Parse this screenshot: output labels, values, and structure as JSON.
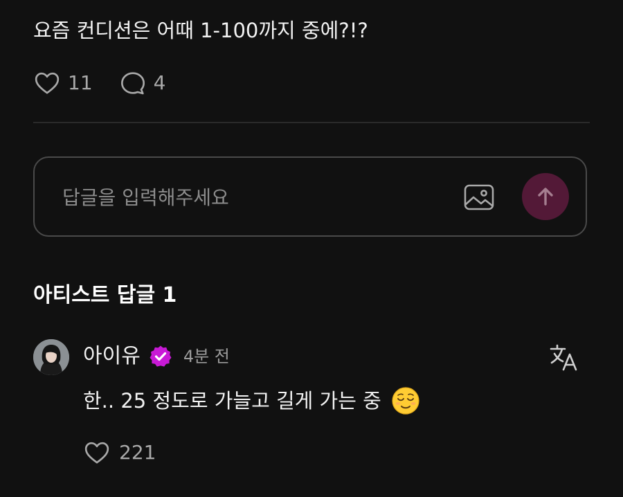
{
  "post": {
    "text": "요즘 컨디션은 어때 1-100까지 중에?!?",
    "likes": "11",
    "comments": "4"
  },
  "reply_box": {
    "placeholder": "답글을 입력해주세요"
  },
  "section": {
    "title": "아티스트 답글 1"
  },
  "comment": {
    "author": "아이유",
    "time": "4분 전",
    "text": "한.. 25 정도로 가늘고 길게 가는 중",
    "emoji": "relieved-face-emoji",
    "likes": "221"
  },
  "colors": {
    "background": "#111111",
    "send_button": "#531937",
    "verified_badge": "#c81ad6",
    "muted_text": "#9b9b9b"
  },
  "icons": [
    "heart-icon",
    "comment-bubble-icon",
    "image-icon",
    "arrow-up-icon",
    "verified-badge-icon",
    "translate-icon"
  ]
}
